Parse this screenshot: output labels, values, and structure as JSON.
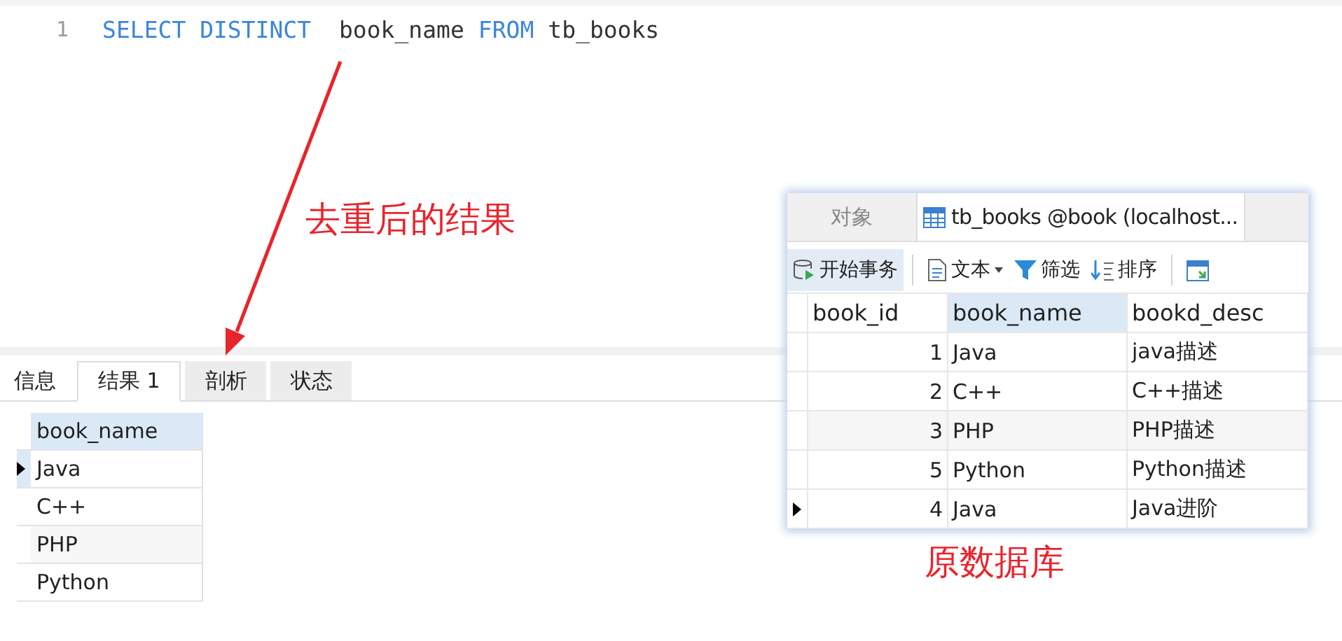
{
  "editor": {
    "line_number": "1",
    "code": [
      {
        "kind": "keyword",
        "text": "SELECT DISTINCT"
      },
      {
        "kind": "plain",
        "text": " book_name"
      },
      {
        "kind": "keyword",
        "text": "FROM"
      },
      {
        "kind": "plain",
        "text": "tb_books"
      }
    ]
  },
  "annotations": [
    {
      "kind": "result",
      "text": "去重后的结果"
    },
    {
      "kind": "source",
      "text": "原数据库"
    }
  ],
  "result_tabs": [
    {
      "label": "信息",
      "selected": false
    },
    {
      "label": "结果 1",
      "selected": true
    },
    {
      "label": "剖析",
      "selected": false
    },
    {
      "label": "状态",
      "selected": false
    }
  ],
  "result_table": {
    "columns": [
      "book_name"
    ],
    "rows": [
      {
        "cells": [
          "Java"
        ],
        "current": true
      },
      {
        "cells": [
          "C++"
        ],
        "current": false
      },
      {
        "cells": [
          "PHP"
        ],
        "current": false
      },
      {
        "cells": [
          "Python"
        ],
        "current": false
      }
    ]
  },
  "table_window": {
    "tabs": [
      {
        "label": "对象",
        "selected": false
      },
      {
        "label": "tb_books @book (localhost...",
        "selected": true
      }
    ],
    "toolbar": [
      {
        "kind": "transaction",
        "label": "开始事务"
      },
      {
        "kind": "text",
        "label": "文本"
      },
      {
        "kind": "filter",
        "label": "筛选"
      },
      {
        "kind": "sort",
        "label": "排序"
      }
    ],
    "columns": [
      "book_id",
      "book_name",
      "bookd_desc"
    ],
    "rows": [
      {
        "cells": [
          "1",
          "Java",
          "java描述"
        ],
        "current": false
      },
      {
        "cells": [
          "2",
          "C++",
          "C++描述"
        ],
        "current": false
      },
      {
        "cells": [
          "3",
          "PHP",
          "PHP描述"
        ],
        "current": false
      },
      {
        "cells": [
          "5",
          "Python",
          "Python描述"
        ],
        "current": false
      },
      {
        "cells": [
          "4",
          "Java",
          "Java进阶"
        ],
        "current": true
      }
    ]
  }
}
